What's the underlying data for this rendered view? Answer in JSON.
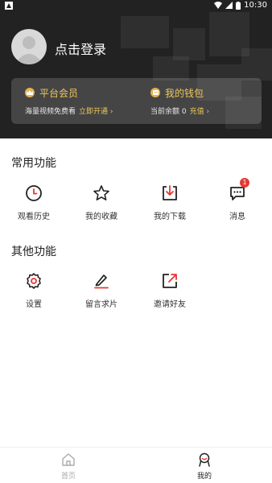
{
  "status_bar": {
    "time": "10:30"
  },
  "profile": {
    "login_text": "点击登录"
  },
  "vip_card": {
    "member": {
      "title": "平台会员",
      "desc": "海量视频免费看",
      "link": "立即开通 ›"
    },
    "wallet": {
      "title": "我的钱包",
      "desc": "当前余额 0",
      "link": "充值 ›"
    }
  },
  "common_functions": {
    "title": "常用功能",
    "items": [
      {
        "label": "观看历史",
        "icon": "clock-icon"
      },
      {
        "label": "我的收藏",
        "icon": "star-icon"
      },
      {
        "label": "我的下载",
        "icon": "download-icon"
      },
      {
        "label": "消息",
        "icon": "message-icon",
        "badge": "1"
      }
    ]
  },
  "other_functions": {
    "title": "其他功能",
    "items": [
      {
        "label": "设置",
        "icon": "gear-icon"
      },
      {
        "label": "留言求片",
        "icon": "edit-icon"
      },
      {
        "label": "邀请好友",
        "icon": "share-icon"
      }
    ]
  },
  "bottom_nav": {
    "items": [
      {
        "label": "首页",
        "icon": "home-icon"
      },
      {
        "label": "我的",
        "icon": "profile-icon",
        "active": true
      }
    ]
  },
  "colors": {
    "header_bg": "#222222",
    "gold": "#f0c75a",
    "badge": "#e53935",
    "accent_red": "#e53935"
  }
}
